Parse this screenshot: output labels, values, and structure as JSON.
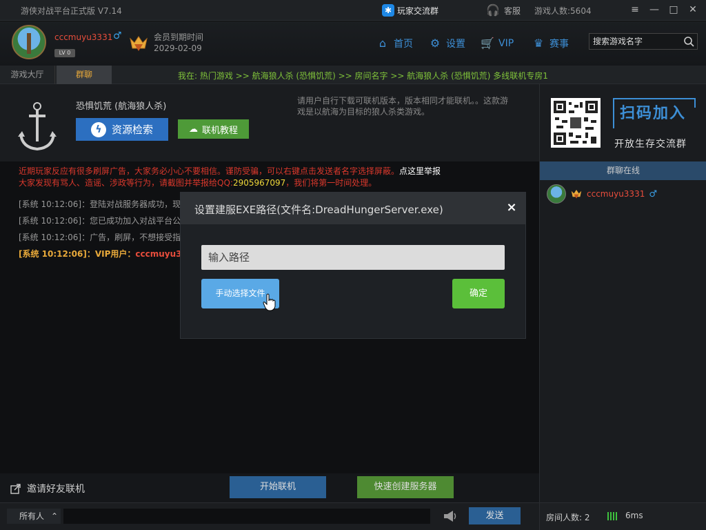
{
  "titlebar": {
    "app_title": "游侠对战平台正式版 V7.14",
    "group_link": "玩家交流群",
    "service": "客服",
    "online_count": "游戏人数:5604",
    "window_buttons": [
      "menu-icon",
      "minimize-icon",
      "maximize-icon",
      "close-icon"
    ]
  },
  "header": {
    "username": "cccmuyu3331",
    "gender_symbol": "♂",
    "level": "LV 0",
    "member_label": "会员到期时间",
    "member_date": "2029-02-09",
    "nav": [
      {
        "label": "首页",
        "icon": "home-icon"
      },
      {
        "label": "设置",
        "icon": "gear-icon"
      },
      {
        "label": "VIP",
        "icon": "cart-icon"
      },
      {
        "label": "赛事",
        "icon": "trophy-icon"
      }
    ],
    "search_placeholder": "搜索游戏名字"
  },
  "tabs": {
    "hall": "游戏大厅",
    "chat": "群聊"
  },
  "location": "我在:  热门游戏 >> 航海狼人杀 (恐惧饥荒)   >> 房间名字 >> 航海狼人杀 (恐惧饥荒)   多线联机专房1",
  "game": {
    "title": "恐惧饥荒 (航海狼人杀)",
    "resource_button": "资源检索",
    "tutorial_button": "联机教程",
    "description": "请用户自行下载可联机版本，版本相同才能联机。。这款游戏是以航海为目标的狼人杀类游戏。"
  },
  "warning": {
    "line1_prefix": "近期玩家反应有很多刷屏广告，大家务必小心不要相信。谨防受骗，可以右键点击发送者名字选择屏蔽。",
    "line1_link": "点这里举报",
    "line2_prefix": "大家发现有骂人、造谣、涉政等行为，请截图并举报给QQ:",
    "line2_qq": "2905967097",
    "line2_suffix": "，我们将第一时间处理。"
  },
  "messages": [
    "[系统 10:12:06]：登陆对战服务器成功，现在",
    "[系统 10:12:06]：您已成功加入对战平台公共",
    "[系统 10:12:06]：广告，刷屏，不想接受指定"
  ],
  "vip_message": {
    "prefix": "[系统 10:12:06]：VIP用户：",
    "name": "cccmuyu3331"
  },
  "actions": {
    "invite": "邀请好友联机",
    "start": "开始联机",
    "quick_create": "快速创建服务器"
  },
  "input": {
    "target": "所有人",
    "send": "发送"
  },
  "right": {
    "scan_join": "扫码加入",
    "open_group": "开放生存交流群",
    "online_header": "群聊在线",
    "member_name": "cccmuyu3331",
    "member_gender": "♂",
    "room_count": "房间人数:  2",
    "ping": "6ms"
  },
  "modal": {
    "title": "设置建服EXE路径(文件名:DreadHungerServer.exe)",
    "close": "×",
    "path_placeholder": "输入路径",
    "choose_button": "手动选择文件",
    "ok_button": "确定"
  },
  "colors": {
    "accent_blue": "#2c6fc0",
    "accent_green": "#5bbf3a",
    "warning_red": "#d9382c",
    "username_red": "#e84d3c",
    "vip_gold": "#e8a93a",
    "location_green": "#7fc23a"
  }
}
